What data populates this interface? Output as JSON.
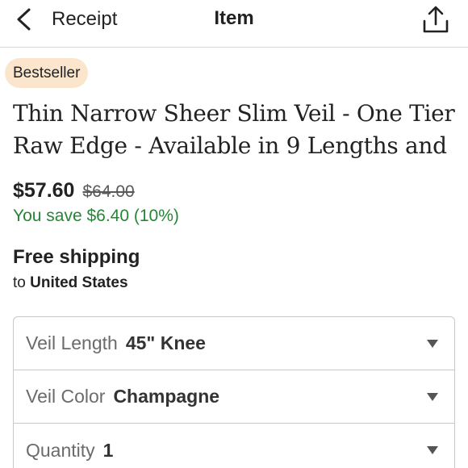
{
  "header": {
    "back_label": "Receipt",
    "title": "Item",
    "back_icon": "chevron-left-icon",
    "share_icon": "share-icon"
  },
  "listing": {
    "badge": "Bestseller",
    "title_line1": "Thin Narrow Sheer Slim Veil - One Tier",
    "title_line2": "Raw Edge - Available in 9 Lengths and",
    "price": "$57.60",
    "original_price": "$64.00",
    "savings": "You save $6.40 (10%)"
  },
  "shipping": {
    "title": "Free shipping",
    "dest_prefix": "to",
    "destination": "United States"
  },
  "options": [
    {
      "label": "Veil Length",
      "value": "45\" Knee"
    },
    {
      "label": "Veil Color",
      "value": "Champagne"
    },
    {
      "label": "Quantity",
      "value": "1"
    }
  ],
  "colors": {
    "badge_bg": "#fbe6cd",
    "savings_green": "#258635",
    "border": "#c8c8c8"
  }
}
